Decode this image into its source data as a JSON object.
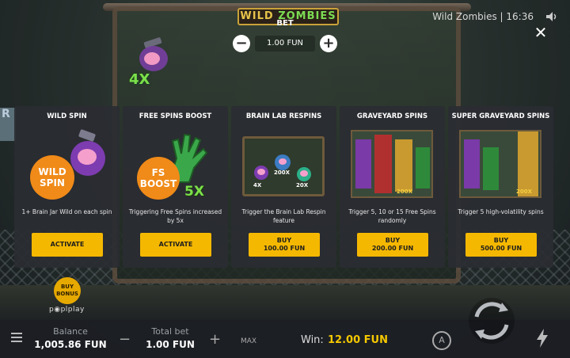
{
  "header": {
    "logo_text_a": "WILD",
    "logo_text_b": "ZOMBIES",
    "title_clock": "Wild Zombies | 16:36",
    "close_icon": "close-icon",
    "sound_icon": "speaker-icon"
  },
  "bet": {
    "label": "BET",
    "value": "1.00 FUN",
    "minus": "−",
    "plus": "+"
  },
  "background": {
    "multiplier": "4X",
    "sign_letter": "R"
  },
  "cards": [
    {
      "title": "WILD SPIN",
      "badge": [
        "WILD",
        "SPIN"
      ],
      "description": "1+ Brain Jar Wild on each spin",
      "button": "ACTIVATE",
      "price": ""
    },
    {
      "title": "FREE SPINS BOOST",
      "badge": [
        "FS",
        "BOOST"
      ],
      "multiplier": "5X",
      "description": "Triggering Free Spins increased by 5x",
      "button": "ACTIVATE",
      "price": ""
    },
    {
      "title": "BRAIN LAB RESPINS",
      "mini": [
        "200X",
        "4X",
        "20X"
      ],
      "description": "Trigger the Brain Lab Respin feature",
      "button": "BUY",
      "price": "100.00 FUN"
    },
    {
      "title": "GRAVEYARD SPINS",
      "mini": [
        "200X"
      ],
      "description": "Trigger 5, 10 or 15 Free Spins randomly",
      "button": "BUY",
      "price": "200.00 FUN"
    },
    {
      "title": "SUPER GRAVEYARD SPINS",
      "mini": [
        "200X"
      ],
      "description": "Trigger 5 high-volatility spins",
      "button": "BUY",
      "price": "500.00 FUN"
    }
  ],
  "buy_bonus": {
    "line1": "BUY",
    "line2": "BONUS"
  },
  "provider": "p◉plplay",
  "bottom_bar": {
    "balance_label": "Balance",
    "balance_value": "1,005.86 FUN",
    "total_bet_label": "Total bet",
    "total_bet_value": "1.00 FUN",
    "minus": "−",
    "plus": "+",
    "max": "MAX",
    "win_label": "Win:",
    "win_value": "12.00 FUN",
    "auto": "A"
  },
  "colors": {
    "accent": "#f5b800",
    "badge_orange": "#f08a18",
    "multiplier_green": "#7be04a",
    "card_bg": "#2a2d32"
  }
}
